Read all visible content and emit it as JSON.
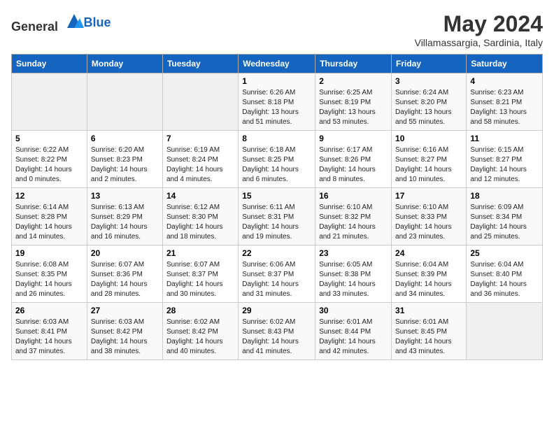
{
  "header": {
    "logo_general": "General",
    "logo_blue": "Blue",
    "month_year": "May 2024",
    "location": "Villamassargia, Sardinia, Italy"
  },
  "weekdays": [
    "Sunday",
    "Monday",
    "Tuesday",
    "Wednesday",
    "Thursday",
    "Friday",
    "Saturday"
  ],
  "weeks": [
    [
      {
        "day": "",
        "info": ""
      },
      {
        "day": "",
        "info": ""
      },
      {
        "day": "",
        "info": ""
      },
      {
        "day": "1",
        "info": "Sunrise: 6:26 AM\nSunset: 8:18 PM\nDaylight: 13 hours\nand 51 minutes."
      },
      {
        "day": "2",
        "info": "Sunrise: 6:25 AM\nSunset: 8:19 PM\nDaylight: 13 hours\nand 53 minutes."
      },
      {
        "day": "3",
        "info": "Sunrise: 6:24 AM\nSunset: 8:20 PM\nDaylight: 13 hours\nand 55 minutes."
      },
      {
        "day": "4",
        "info": "Sunrise: 6:23 AM\nSunset: 8:21 PM\nDaylight: 13 hours\nand 58 minutes."
      }
    ],
    [
      {
        "day": "5",
        "info": "Sunrise: 6:22 AM\nSunset: 8:22 PM\nDaylight: 14 hours\nand 0 minutes."
      },
      {
        "day": "6",
        "info": "Sunrise: 6:20 AM\nSunset: 8:23 PM\nDaylight: 14 hours\nand 2 minutes."
      },
      {
        "day": "7",
        "info": "Sunrise: 6:19 AM\nSunset: 8:24 PM\nDaylight: 14 hours\nand 4 minutes."
      },
      {
        "day": "8",
        "info": "Sunrise: 6:18 AM\nSunset: 8:25 PM\nDaylight: 14 hours\nand 6 minutes."
      },
      {
        "day": "9",
        "info": "Sunrise: 6:17 AM\nSunset: 8:26 PM\nDaylight: 14 hours\nand 8 minutes."
      },
      {
        "day": "10",
        "info": "Sunrise: 6:16 AM\nSunset: 8:27 PM\nDaylight: 14 hours\nand 10 minutes."
      },
      {
        "day": "11",
        "info": "Sunrise: 6:15 AM\nSunset: 8:27 PM\nDaylight: 14 hours\nand 12 minutes."
      }
    ],
    [
      {
        "day": "12",
        "info": "Sunrise: 6:14 AM\nSunset: 8:28 PM\nDaylight: 14 hours\nand 14 minutes."
      },
      {
        "day": "13",
        "info": "Sunrise: 6:13 AM\nSunset: 8:29 PM\nDaylight: 14 hours\nand 16 minutes."
      },
      {
        "day": "14",
        "info": "Sunrise: 6:12 AM\nSunset: 8:30 PM\nDaylight: 14 hours\nand 18 minutes."
      },
      {
        "day": "15",
        "info": "Sunrise: 6:11 AM\nSunset: 8:31 PM\nDaylight: 14 hours\nand 19 minutes."
      },
      {
        "day": "16",
        "info": "Sunrise: 6:10 AM\nSunset: 8:32 PM\nDaylight: 14 hours\nand 21 minutes."
      },
      {
        "day": "17",
        "info": "Sunrise: 6:10 AM\nSunset: 8:33 PM\nDaylight: 14 hours\nand 23 minutes."
      },
      {
        "day": "18",
        "info": "Sunrise: 6:09 AM\nSunset: 8:34 PM\nDaylight: 14 hours\nand 25 minutes."
      }
    ],
    [
      {
        "day": "19",
        "info": "Sunrise: 6:08 AM\nSunset: 8:35 PM\nDaylight: 14 hours\nand 26 minutes."
      },
      {
        "day": "20",
        "info": "Sunrise: 6:07 AM\nSunset: 8:36 PM\nDaylight: 14 hours\nand 28 minutes."
      },
      {
        "day": "21",
        "info": "Sunrise: 6:07 AM\nSunset: 8:37 PM\nDaylight: 14 hours\nand 30 minutes."
      },
      {
        "day": "22",
        "info": "Sunrise: 6:06 AM\nSunset: 8:37 PM\nDaylight: 14 hours\nand 31 minutes."
      },
      {
        "day": "23",
        "info": "Sunrise: 6:05 AM\nSunset: 8:38 PM\nDaylight: 14 hours\nand 33 minutes."
      },
      {
        "day": "24",
        "info": "Sunrise: 6:04 AM\nSunset: 8:39 PM\nDaylight: 14 hours\nand 34 minutes."
      },
      {
        "day": "25",
        "info": "Sunrise: 6:04 AM\nSunset: 8:40 PM\nDaylight: 14 hours\nand 36 minutes."
      }
    ],
    [
      {
        "day": "26",
        "info": "Sunrise: 6:03 AM\nSunset: 8:41 PM\nDaylight: 14 hours\nand 37 minutes."
      },
      {
        "day": "27",
        "info": "Sunrise: 6:03 AM\nSunset: 8:42 PM\nDaylight: 14 hours\nand 38 minutes."
      },
      {
        "day": "28",
        "info": "Sunrise: 6:02 AM\nSunset: 8:42 PM\nDaylight: 14 hours\nand 40 minutes."
      },
      {
        "day": "29",
        "info": "Sunrise: 6:02 AM\nSunset: 8:43 PM\nDaylight: 14 hours\nand 41 minutes."
      },
      {
        "day": "30",
        "info": "Sunrise: 6:01 AM\nSunset: 8:44 PM\nDaylight: 14 hours\nand 42 minutes."
      },
      {
        "day": "31",
        "info": "Sunrise: 6:01 AM\nSunset: 8:45 PM\nDaylight: 14 hours\nand 43 minutes."
      },
      {
        "day": "",
        "info": ""
      }
    ]
  ]
}
